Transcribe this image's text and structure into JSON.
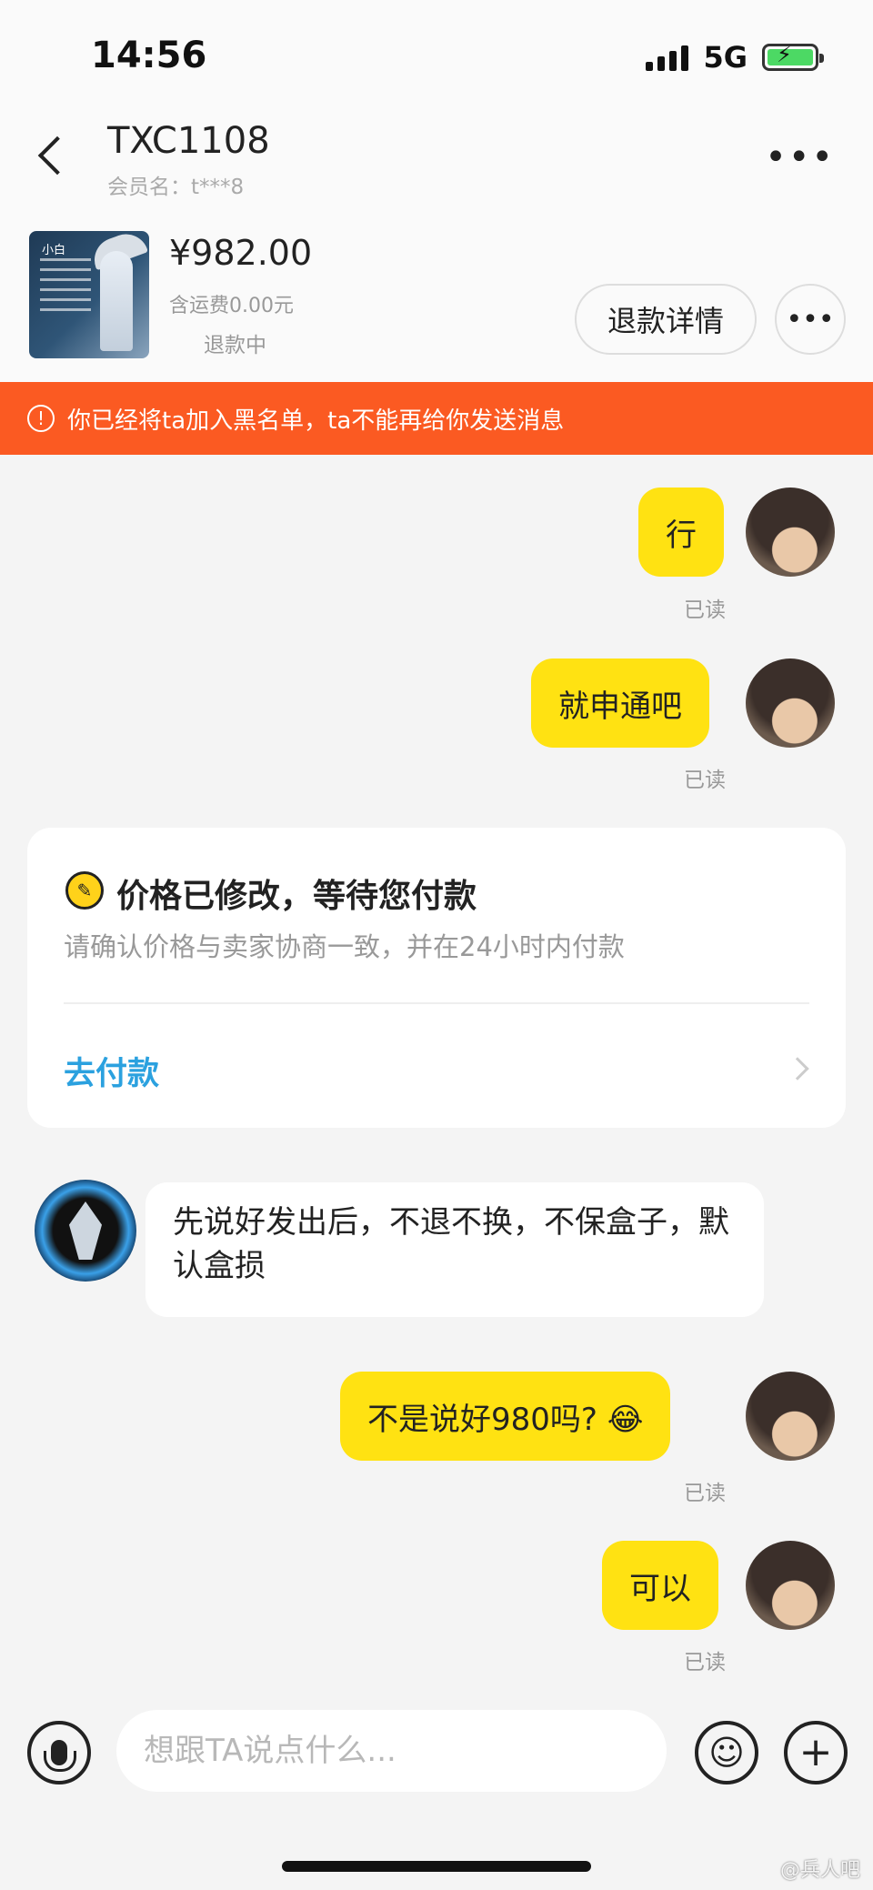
{
  "status_bar": {
    "time": "14:56",
    "network": "5G",
    "battery_icon": "battery-charging-icon"
  },
  "header": {
    "title": "TXC1108",
    "subtitle": "会员名：t***8",
    "more": "•••"
  },
  "product": {
    "price": "¥982.00",
    "shipping": "含运费0.00元",
    "status": "退款中",
    "refund_button": "退款详情",
    "more_button": "•••",
    "thumb_label": "小白"
  },
  "banner": {
    "icon": "!",
    "text": "你已经将ta加入黑名单，ta不能再给你发送消息",
    "color": "#fb5a22"
  },
  "messages": [
    {
      "side": "me",
      "text": "行",
      "read": "已读"
    },
    {
      "side": "me",
      "text": "就申通吧",
      "read": "已读"
    },
    {
      "side": "other",
      "text": "先说好发出后，不退不换，不保盒子，默认盒损"
    },
    {
      "side": "me",
      "text": "不是说好980吗? 😂",
      "read": "已读"
    },
    {
      "side": "me",
      "text": "可以",
      "read": "已读"
    }
  ],
  "price_card": {
    "icon": "✎",
    "title": "价格已修改，等待您付款",
    "description": "请确认价格与卖家协商一致，并在24小时内付款",
    "action": "去付款",
    "link_color": "#2ba1df"
  },
  "input_bar": {
    "placeholder": "想跟TA说点什么...",
    "emoji": "☺",
    "plus": "+"
  },
  "watermark": "@兵人吧",
  "colors": {
    "bubble_me": "#ffe212",
    "bubble_other": "#ffffff",
    "background": "#f4f4f4"
  }
}
